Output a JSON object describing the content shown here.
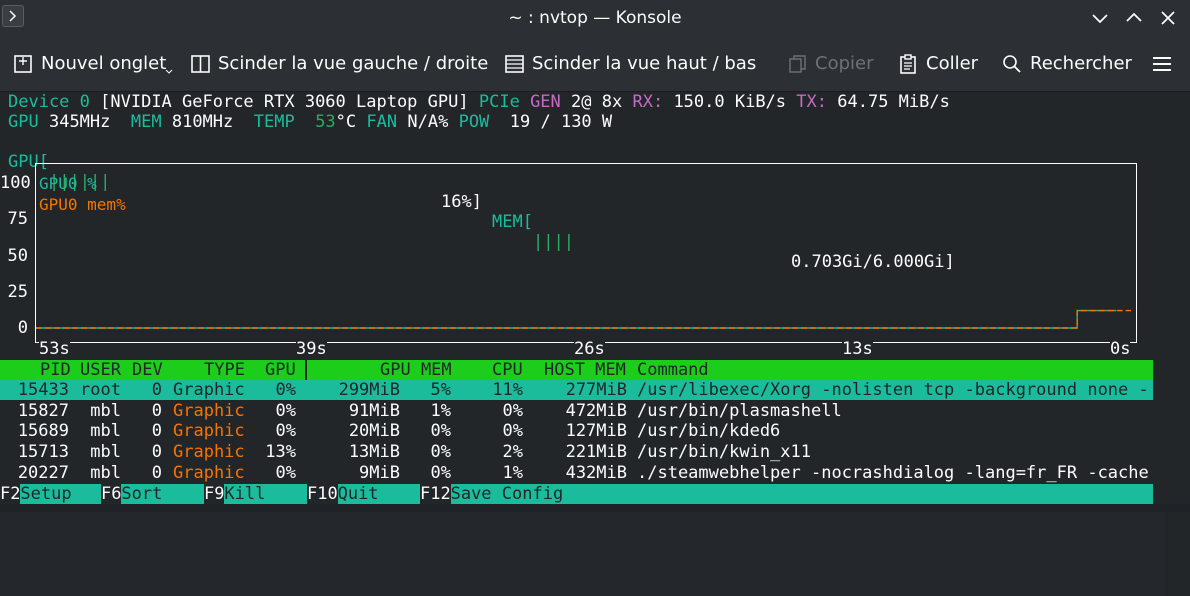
{
  "window": {
    "title": "~ : nvtop — Konsole"
  },
  "toolbar": {
    "new_tab": "Nouvel onglet",
    "split_lr": "Scinder la vue gauche / droite",
    "split_tb": "Scinder la vue haut / bas",
    "copy": "Copier",
    "paste": "Coller",
    "search": "Rechercher"
  },
  "device": {
    "label": "Device 0",
    "name": "[NVIDIA GeForce RTX 3060 Laptop GPU]",
    "pcie": "PCIe",
    "gen_label": "GEN",
    "gen": "2@ 8x",
    "rx_label": "RX:",
    "rx": "150.0 KiB/s",
    "tx_label": "TX:",
    "tx": "64.75 MiB/s",
    "gpu_clock_label": "GPU",
    "gpu_clock": "345MHz",
    "mem_clock_label": "MEM",
    "mem_clock": "810MHz",
    "temp_label": "TEMP",
    "temp_value": "53",
    "temp_unit": "°C",
    "fan_label": "FAN",
    "fan": "N/A%",
    "pow_label": "POW",
    "pow": "19 / 130 W",
    "gpu_bar_label": "GPU[",
    "gpu_bar": "||||||",
    "gpu_pct": "16%]",
    "mem_bar_label": "MEM[",
    "mem_bar": "||||",
    "mem_usage": "0.703Gi/6.000Gi]"
  },
  "chart_data": {
    "type": "line",
    "yticks": [
      "100",
      "75",
      "50",
      "25",
      "0"
    ],
    "xticks": [
      "53s",
      "39s",
      "26s",
      "13s",
      "0s"
    ],
    "ylim": [
      0,
      100
    ],
    "legend_placement": "top-left",
    "series": [
      {
        "name": "GPU0 %",
        "color": "#1abc9c",
        "points": [
          [
            53,
            0
          ],
          [
            2,
            0
          ],
          [
            2,
            12
          ],
          [
            0,
            12
          ]
        ]
      },
      {
        "name": "GPU0 mem%",
        "color": "#f67400",
        "points": [
          [
            53,
            0
          ],
          [
            2,
            0
          ],
          [
            2,
            12
          ],
          [
            0,
            12
          ]
        ]
      }
    ]
  },
  "processes": {
    "headers": [
      "PID",
      "USER",
      "DEV",
      "TYPE",
      "GPU",
      "GPU MEM",
      "CPU",
      "HOST MEM",
      "Command"
    ],
    "rows": [
      {
        "pid": "15433",
        "user": "root",
        "dev": "0",
        "type": "Graphic",
        "gpu": "0%",
        "gpumem": "299MiB",
        "gpumempct": "5%",
        "cpu": "11%",
        "hostmem": "277MiB",
        "cmd": "/usr/libexec/Xorg -nolisten tcp -background none -"
      },
      {
        "pid": "15827",
        "user": "mbl",
        "dev": "0",
        "type": "Graphic",
        "gpu": "0%",
        "gpumem": "91MiB",
        "gpumempct": "1%",
        "cpu": "0%",
        "hostmem": "472MiB",
        "cmd": "/usr/bin/plasmashell"
      },
      {
        "pid": "15689",
        "user": "mbl",
        "dev": "0",
        "type": "Graphic",
        "gpu": "0%",
        "gpumem": "20MiB",
        "gpumempct": "0%",
        "cpu": "0%",
        "hostmem": "127MiB",
        "cmd": "/usr/bin/kded6"
      },
      {
        "pid": "15713",
        "user": "mbl",
        "dev": "0",
        "type": "Graphic",
        "gpu": "13%",
        "gpumem": "13MiB",
        "gpumempct": "0%",
        "cpu": "2%",
        "hostmem": "221MiB",
        "cmd": "/usr/bin/kwin_x11"
      },
      {
        "pid": "20227",
        "user": "mbl",
        "dev": "0",
        "type": "Graphic",
        "gpu": "0%",
        "gpumem": "9MiB",
        "gpumempct": "0%",
        "cpu": "1%",
        "hostmem": "432MiB",
        "cmd": "./steamwebhelper -nocrashdialog -lang=fr_FR -cache"
      }
    ]
  },
  "fkeys": [
    {
      "key": "F2",
      "label": "Setup"
    },
    {
      "key": "F6",
      "label": "Sort"
    },
    {
      "key": "F9",
      "label": "Kill"
    },
    {
      "key": "F10",
      "label": "Quit"
    },
    {
      "key": "F12",
      "label": "Save Config"
    }
  ]
}
